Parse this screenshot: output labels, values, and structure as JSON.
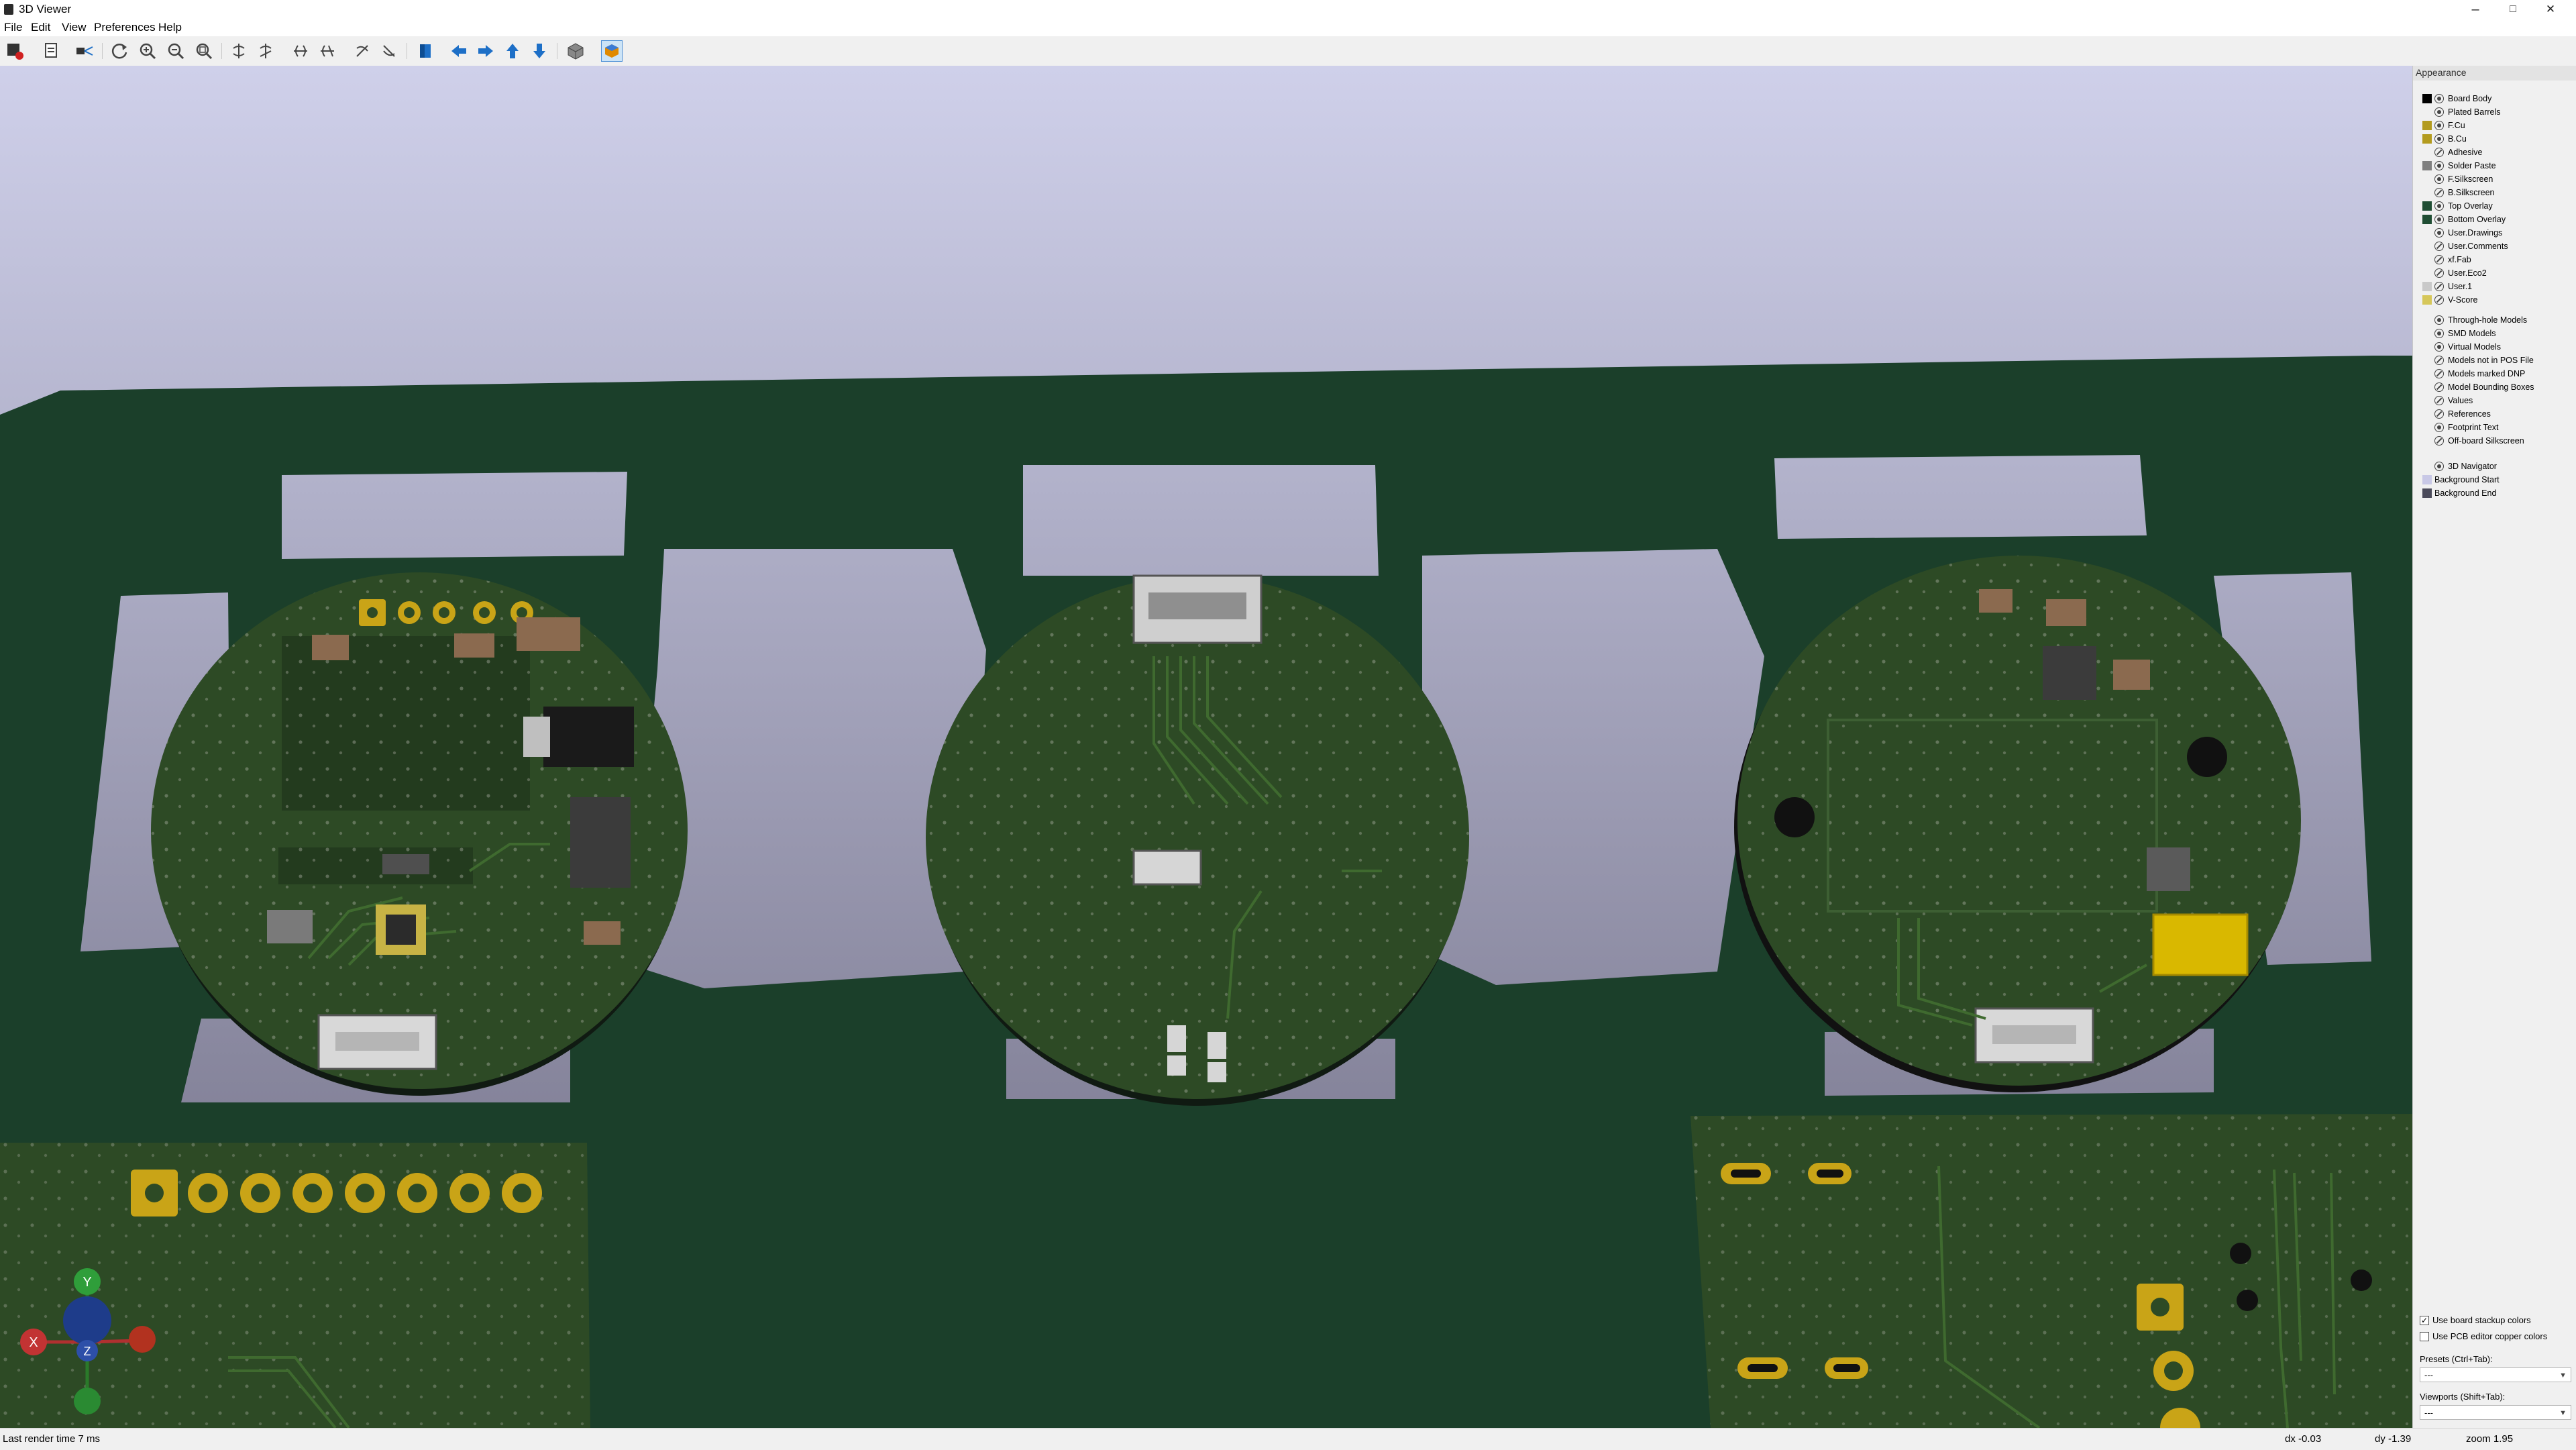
{
  "window": {
    "title": "3D Viewer",
    "minimize": "–",
    "maximize": "□",
    "close": "✕"
  },
  "menu": [
    "File",
    "Edit",
    "View",
    "Preferences",
    "Help"
  ],
  "toolbar_icons": [
    "render-options-icon",
    "copy-image-icon",
    "raytrace-icon",
    "reload-icon",
    "zoom-in-icon",
    "zoom-out-icon",
    "zoom-fit-icon",
    "rotate-x-cw-icon",
    "rotate-x-ccw-icon",
    "rotate-y-cw-icon",
    "rotate-y-ccw-icon",
    "rotate-z-cw-icon",
    "rotate-z-ccw-icon",
    "flip-board-icon",
    "pan-left-icon",
    "pan-right-icon",
    "pan-up-icon",
    "pan-down-icon",
    "toggle-ortho-icon",
    "toggle-axes-icon"
  ],
  "panel": {
    "title": "Appearance",
    "layers": [
      {
        "label": "Board Body",
        "color": "#000000",
        "visible": true
      },
      {
        "label": "Plated Barrels",
        "color": "",
        "visible": true
      },
      {
        "label": "F.Cu",
        "color": "#b39b1e",
        "visible": true
      },
      {
        "label": "B.Cu",
        "color": "#b39b1e",
        "visible": true
      },
      {
        "label": "Adhesive",
        "color": "",
        "visible": false
      },
      {
        "label": "Solder Paste",
        "color": "#808080",
        "visible": true
      },
      {
        "label": "F.Silkscreen",
        "color": "",
        "visible": true
      },
      {
        "label": "B.Silkscreen",
        "color": "",
        "visible": false
      },
      {
        "label": "Top Overlay",
        "color": "#1f4d33",
        "visible": true
      },
      {
        "label": "Bottom Overlay",
        "color": "#1f4d33",
        "visible": true
      },
      {
        "label": "User.Drawings",
        "color": "",
        "visible": true
      },
      {
        "label": "User.Comments",
        "color": "",
        "visible": false
      },
      {
        "label": "xf.Fab",
        "color": "",
        "visible": false
      },
      {
        "label": "User.Eco2",
        "color": "",
        "visible": false
      },
      {
        "label": "User.1",
        "color": "#c9c9c9",
        "visible": false
      },
      {
        "label": "V-Score",
        "color": "#d6c75a",
        "visible": false
      }
    ],
    "models": [
      {
        "label": "Through-hole Models",
        "visible": true
      },
      {
        "label": "SMD Models",
        "visible": true
      },
      {
        "label": "Virtual Models",
        "visible": true
      },
      {
        "label": "Models not in POS File",
        "visible": false
      },
      {
        "label": "Models marked DNP",
        "visible": false
      },
      {
        "label": "Model Bounding Boxes",
        "visible": false
      }
    ],
    "text": [
      {
        "label": "Values",
        "visible": false
      },
      {
        "label": "References",
        "visible": false
      },
      {
        "label": "Footprint Text",
        "visible": true
      },
      {
        "label": "Off-board Silkscreen",
        "visible": false
      }
    ],
    "misc": [
      {
        "label": "3D Navigator",
        "visible": true,
        "color": ""
      },
      {
        "label": "Background Start",
        "visible": null,
        "color": "#c8c8e6"
      },
      {
        "label": "Background End",
        "visible": null,
        "color": "#4a4a5a"
      }
    ],
    "use_board_stackup_colors": "Use board stackup colors",
    "use_pcb_editor_copper_colors": "Use PCB editor copper colors",
    "presets_label": "Presets (Ctrl+Tab):",
    "presets_value": "---",
    "viewports_label": "Viewports (Shift+Tab):",
    "viewports_value": "---"
  },
  "status": {
    "render_time": "Last render time 7 ms",
    "dx": "dx -0.03",
    "dy": "dy -1.39",
    "zoom": "zoom 1.95"
  },
  "navigator": {
    "x_label": "X",
    "y_label": "Y",
    "z_label": "Z"
  }
}
